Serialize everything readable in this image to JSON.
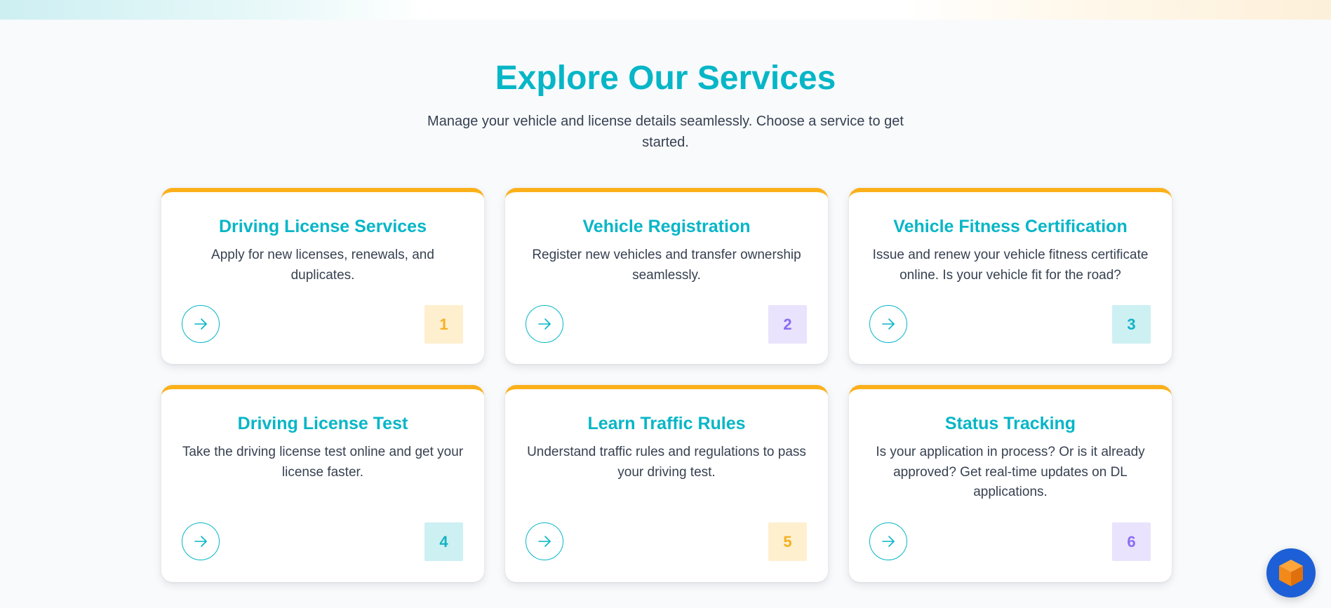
{
  "header": {
    "title": "Explore Our Services",
    "subtitle": "Manage your vehicle and license details seamlessly. Choose a service to get started."
  },
  "services": [
    {
      "title": "Driving License Services",
      "description": "Apply for new licenses, renewals, and duplicates.",
      "number": "1",
      "badge_color": "#f5b020",
      "action_icon": "arrow-right-icon"
    },
    {
      "title": "Vehicle Registration",
      "description": "Register new vehicles and transfer ownership seamlessly.",
      "number": "2",
      "badge_color": "#8b6cf3",
      "action_icon": "arrow-right-icon"
    },
    {
      "title": "Vehicle Fitness Certification",
      "description": "Issue and renew your vehicle fitness certificate online. Is your vehicle fit for the road?",
      "number": "3",
      "badge_color": "#13b4c3",
      "action_icon": "arrow-right-icon"
    },
    {
      "title": "Driving License Test",
      "description": "Take the driving license test online and get your license faster.",
      "number": "4",
      "badge_color": "#13b4c3",
      "action_icon": "arrow-right-icon"
    },
    {
      "title": "Learn Traffic Rules",
      "description": "Understand traffic rules and regulations to pass your driving test.",
      "number": "5",
      "badge_color": "#f5b020",
      "action_icon": "arrow-right-icon"
    },
    {
      "title": "Status Tracking",
      "description": "Is your application in process? Or is it already approved? Get real-time updates on DL applications.",
      "number": "6",
      "badge_color": "#8b6cf3",
      "action_icon": "arrow-right-icon"
    }
  ],
  "widget": {
    "icon": "cube-icon"
  },
  "colors": {
    "accent": "#06b6c7",
    "card_border": "#fbb01a",
    "widget_bg": "#1d5fd6",
    "widget_cube": "#f28a1a"
  }
}
